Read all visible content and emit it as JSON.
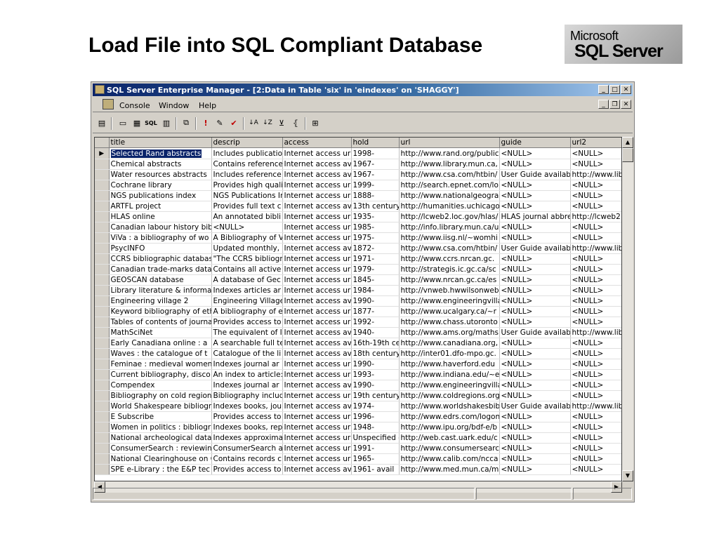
{
  "slide": {
    "title": "Load File into SQL Compliant Database",
    "logo_line1": "Microsoft",
    "logo_line2": "SQL Server"
  },
  "window": {
    "title": "SQL Server Enterprise Manager - [2:Data in Table 'six' in 'eindexes' on 'SHAGGY']",
    "app_icon": "enterprise-manager-icon",
    "controls": [
      "minimize",
      "maximize",
      "close"
    ]
  },
  "menu": {
    "items": [
      "Console",
      "Window",
      "Help"
    ]
  },
  "toolbar": {
    "icons": [
      "properties-icon",
      "show-diagram-icon",
      "show-grid-icon",
      "show-sql-icon",
      "show-results-icon",
      "change-query-type-icon",
      "run-icon",
      "verify-sql-icon",
      "cancel-query-icon",
      "sort-ascending-icon",
      "sort-descending-icon",
      "remove-filter-icon",
      "group-by-icon",
      "add-table-icon"
    ]
  },
  "grid": {
    "columns": [
      "title",
      "descrip",
      "access",
      "hold",
      "url",
      "guide",
      "url2"
    ],
    "rows": [
      [
        "Selected Rand abstracts",
        "Includes publicatio",
        "Internet access ur",
        "1998-",
        "http://www.rand.org/public",
        "<NULL>",
        "<NULL>"
      ],
      [
        "Chemical abstracts",
        "Contains reference",
        "Internet access av",
        "1967-",
        "http://www.library.mun.ca,",
        "<NULL>",
        "<NULL>"
      ],
      [
        "Water resources abstracts",
        "Includes reference",
        "Internet access av",
        "1967-",
        "http://www.csa.com/htbin/",
        "User Guide availabl",
        "http://www.lib"
      ],
      [
        "Cochrane library",
        "Provides high quali",
        "Internet access ur",
        "1999-",
        "http://search.epnet.com/lo",
        "<NULL>",
        "<NULL>"
      ],
      [
        "NGS publications index",
        "NGS Publications Ir",
        "Internet access ur",
        "1888-",
        "http://www.nationalgeogra",
        "<NULL>",
        "<NULL>"
      ],
      [
        "ARTFL project",
        "Provides full text c",
        "Internet access av",
        "13th century",
        "http://humanities.uchicago",
        "<NULL>",
        "<NULL>"
      ],
      [
        "HLAS online",
        "An annotated bibli",
        "Internet access ur",
        "1935-",
        "http://lcweb2.loc.gov/hlas/",
        "HLAS journal abbre",
        "http://lcweb2"
      ],
      [
        "Canadian labour history bib",
        "<NULL>",
        "Internet access ur",
        "1985-",
        "http://info.library.mun.ca/u",
        "<NULL>",
        "<NULL>"
      ],
      [
        "ViVa  : a bibliography of wo",
        "A Bibliography of V",
        "Internet access ur",
        "1975-",
        "http://www.iisg.nl/~womhi",
        "<NULL>",
        "<NULL>"
      ],
      [
        "PsycINFO",
        "Updated monthly,",
        "Internet access av",
        "1872-",
        "http://www.csa.com/htbin/",
        "User Guide availabl",
        "http://www.lib"
      ],
      [
        "CCRS bibliographic databas",
        "\"The CCRS bibliogr",
        "Internet access ur",
        "1971-",
        "http://www.ccrs.nrcan.gc.",
        "<NULL>",
        "<NULL>"
      ],
      [
        "Canadian trade-marks data",
        "Contains all active",
        "Internet access ur",
        "1979-",
        "http://strategis.ic.gc.ca/sc",
        "<NULL>",
        "<NULL>"
      ],
      [
        "GEOSCAN database",
        "A database of Gec",
        "Internet access ur",
        "1845-",
        "http://www.nrcan.gc.ca/es",
        "<NULL>",
        "<NULL>"
      ],
      [
        "Library literature & informat",
        "Indexes articles ar",
        "Internet access ur",
        "1984-",
        "http://vnweb.hwwilsonweb",
        "<NULL>",
        "<NULL>"
      ],
      [
        "Engineering village 2",
        "Engineering Village",
        "Internet access av",
        "1990-",
        "http://www.engineeringvilla",
        "<NULL>",
        "<NULL>"
      ],
      [
        "Keyword bibliography of eth",
        "A bibliography of e",
        "Internet access ur",
        "1877-",
        "http://www.ucalgary.ca/~r",
        "<NULL>",
        "<NULL>"
      ],
      [
        "Tables of contents of journa",
        "Provides access to",
        "Internet access ur",
        "1992-",
        "http://www.chass.utoronto",
        "<NULL>",
        "<NULL>"
      ],
      [
        "MathSciNet",
        "The equivalent of I",
        "Internet access av",
        "1940-",
        "http://www.ams.org/maths",
        "User Guide availabl",
        "http://www.lib"
      ],
      [
        "Early Canadiana online  : a",
        "A searchable full te",
        "Internet access av",
        "16th-19th ce",
        "http://www.canadiana.org,",
        "<NULL>",
        "<NULL>"
      ],
      [
        "Waves  : the catalogue of t",
        "Catalogue of the li",
        "Internet access av",
        "18th century",
        "http://inter01.dfo-mpo.gc.",
        "<NULL>",
        "<NULL>"
      ],
      [
        "Feminae  : medieval women",
        "Indexes journal ar",
        "Internet access ur",
        "1990-",
        "http://www.haverford.edu",
        "<NULL>",
        "<NULL>"
      ],
      [
        "Current bibliography, disco",
        "An index to article:",
        "Internet access ur",
        "1993-",
        "http://www.indiana.edu/~e",
        "<NULL>",
        "<NULL>"
      ],
      [
        "Compendex",
        "Indexes journal ar",
        "Internet access av",
        "1990-",
        "http://www.engineeringvilla",
        "<NULL>",
        "<NULL>"
      ],
      [
        "Bibliography on cold regions",
        "Bibliography includ",
        "Internet access ur",
        "19th century",
        "http://www.coldregions.org",
        "<NULL>",
        "<NULL>"
      ],
      [
        "World Shakespeare bibliogr",
        "Indexes books, jou",
        "Internet access av",
        "1974-",
        "http://www.worldshakesbib",
        "User Guide availabl",
        "http://www.lib"
      ],
      [
        "E Subscribe",
        "Provides access to",
        "Internet access ur",
        "1996-",
        "http://www.edrs.com/logon",
        "<NULL>",
        "<NULL>"
      ],
      [
        "Women in politics  : bibliogr",
        "Indexes books, rep",
        "Internet access ur",
        "1948-",
        "http://www.ipu.org/bdf-e/b",
        "<NULL>",
        "<NULL>"
      ],
      [
        "National archeological datal",
        "Indexes approxima",
        "Internet access ur",
        "Unspecified c",
        "http://web.cast.uark.edu/c",
        "<NULL>",
        "<NULL>"
      ],
      [
        "ConsumerSearch  : reviewin",
        "ConsumerSearch a",
        "Internet access ur",
        "1991-",
        "http://www.consumersearc",
        "<NULL>",
        "<NULL>"
      ],
      [
        "National Clearinghouse on C",
        "Contains records c",
        "Internet access ur",
        "1965-",
        "http://www.calib.com/ncca",
        "<NULL>",
        "<NULL>"
      ],
      [
        "SPE e-Library  : the E&P tec",
        "Provides access to",
        "Internet access av",
        "1961-   avail",
        "http://www.med.mun.ca/m",
        "<NULL>",
        "<NULL>"
      ]
    ]
  }
}
